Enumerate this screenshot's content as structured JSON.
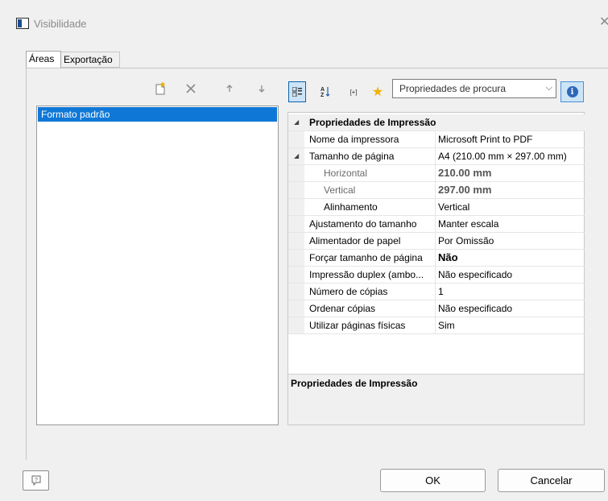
{
  "window": {
    "title": "Visibilidade",
    "close_icon": "close-icon"
  },
  "tabs": [
    {
      "label": "Áreas",
      "active": true
    },
    {
      "label": "Exportação",
      "active": false
    }
  ],
  "list_toolbar": {
    "icons": [
      "new-item-icon",
      "delete-icon",
      "move-up-icon",
      "move-down-icon"
    ]
  },
  "list": {
    "items": [
      {
        "label": "Formato padrão",
        "selected": true
      }
    ]
  },
  "prop_toolbar": {
    "icons": [
      "categorized-icon",
      "sort-alpha-icon",
      "expand-icon",
      "favorite-icon",
      "info-icon"
    ],
    "expand_glyph": "[+]",
    "search_combo": {
      "value": "Propriedades de procura"
    }
  },
  "properties": {
    "category": "Propriedades de Impressão",
    "rows": [
      {
        "name": "Nome da impressora",
        "value": "Microsoft Print to PDF"
      },
      {
        "name": "Tamanho de página",
        "value": "A4  (210.00 mm × 297.00 mm)"
      },
      {
        "name": "Horizontal",
        "value": "210.00 mm"
      },
      {
        "name": "Vertical",
        "value": "297.00 mm"
      },
      {
        "name": "Alinhamento",
        "value": "Vertical"
      },
      {
        "name": "Ajustamento do tamanho",
        "value": "Manter escala"
      },
      {
        "name": "Alimentador de papel",
        "value": "Por Omissão"
      },
      {
        "name": "Forçar tamanho de página",
        "value": "Não"
      },
      {
        "name": "Impressão duplex (ambo...",
        "value": "Não especificado"
      },
      {
        "name": "Número de cópias",
        "value": "1"
      },
      {
        "name": "Ordenar cópias",
        "value": "Não especificado"
      },
      {
        "name": "Utilizar páginas físicas",
        "value": "Sim"
      }
    ],
    "description_title": "Propriedades de Impressão"
  },
  "footer": {
    "help_icon": "help-icon",
    "ok_label": "OK",
    "cancel_label": "Cancelar"
  }
}
